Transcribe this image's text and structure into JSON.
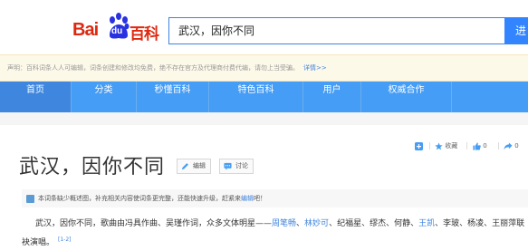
{
  "logo": {
    "bai": "Bai",
    "du": "du",
    "baike": "百科"
  },
  "search": {
    "value": "武汉，因你不同",
    "button": "进"
  },
  "notice": {
    "text": "声明：百科词条人人可编辑，词条创建和修改均免费，绝不存在官方及代理商付费代编，请勿上当受骗。",
    "more": "详情>>"
  },
  "nav": {
    "items": [
      {
        "label": "首页"
      },
      {
        "label": "分类"
      },
      {
        "label": "秒懂百科"
      },
      {
        "label": "特色百科"
      },
      {
        "label": "用户"
      },
      {
        "label": "权威合作"
      }
    ]
  },
  "tools": {
    "favorite": "收藏",
    "like_count": "0",
    "share_count": "0"
  },
  "entry": {
    "title": "武汉，因你不同",
    "edit": "编辑",
    "discuss": "讨论"
  },
  "prompt": {
    "before": "本词条缺少概述图，补充相关内容使词条更完整，还能快速升级，赶紧来",
    "link": "编辑",
    "after": "吧！"
  },
  "summary": {
    "part1": "武汉，因你不同，歌曲由冯具作曲、吴瑾作词，众多文体明星——",
    "link1": "周笔畅",
    "sep1": "、",
    "link2": "林妙可",
    "part2": "、纪福星、缪杰、何静、",
    "link3": "王凯",
    "part3": "、李玻、杨凌、王丽萍联袂演唱。",
    "ref": "[1-2]"
  },
  "colors": {
    "brand_red": "#de2910",
    "nav_blue": "#459df5",
    "link_blue": "#3e83dd"
  }
}
